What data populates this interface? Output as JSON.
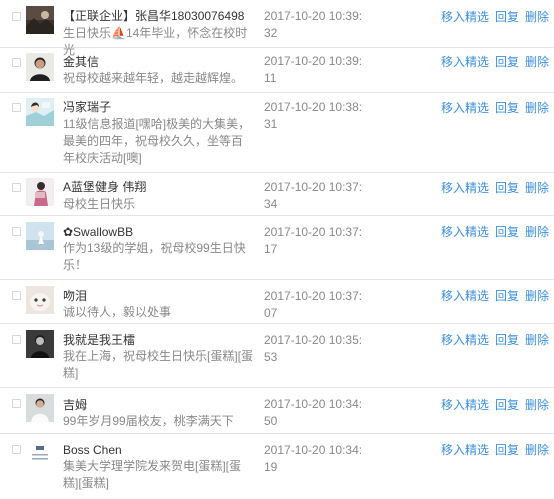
{
  "actions": {
    "feature": "移入精选",
    "reply": "回复",
    "delete": "删除"
  },
  "colors": {
    "link": "#3d8fdd",
    "muted": "#888888",
    "text": "#333333",
    "divider": "#e4e4e4"
  },
  "comments": [
    {
      "name": "【正联企业】张昌华18030076498",
      "message": "生日快乐⛵14年毕业，怀念在校时光",
      "time": "2017-10-20 10:39:32",
      "avatar": "avatar-landscape"
    },
    {
      "name": "金其信",
      "message": "祝母校越来越年轻，越走越辉煌。",
      "time": "2017-10-20 10:39:11",
      "avatar": "avatar-portrait-man"
    },
    {
      "name": "冯家瑞子",
      "message": "11级信息报道[嘿哈]极美的大集美，最美的四年，祝母校久久，坐等百年校庆活动[噢]",
      "time": "2017-10-20 10:38:31",
      "avatar": "avatar-anime"
    },
    {
      "name": "A蓝堡健身 伟翔",
      "message": "母校生日快乐",
      "time": "2017-10-20 10:37:34",
      "avatar": "avatar-fitness"
    },
    {
      "name": "✿SwallowBB",
      "message": "作为13级的学姐，祝母校99生日快乐！",
      "time": "2017-10-20 10:37:17",
      "avatar": "avatar-sky"
    },
    {
      "name": "吻泪",
      "message": "诚以待人，毅以处事",
      "time": "2017-10-20 10:37:07",
      "avatar": "avatar-cat"
    },
    {
      "name": "我就是我王檑",
      "message": "我在上海，祝母校生日快乐[蛋糕][蛋糕]",
      "time": "2017-10-20 10:35:53",
      "avatar": "avatar-bw-portrait"
    },
    {
      "name": "吉姆",
      "message": "99年岁月99届校友，桃李满天下",
      "time": "2017-10-20 10:34:50",
      "avatar": "avatar-white-shirt"
    },
    {
      "name": "Boss Chen",
      "message": "集美大学理学院发来贺电[蛋糕][蛋糕][蛋糕]",
      "time": "2017-10-20 10:34:19",
      "avatar": "avatar-logo"
    }
  ]
}
